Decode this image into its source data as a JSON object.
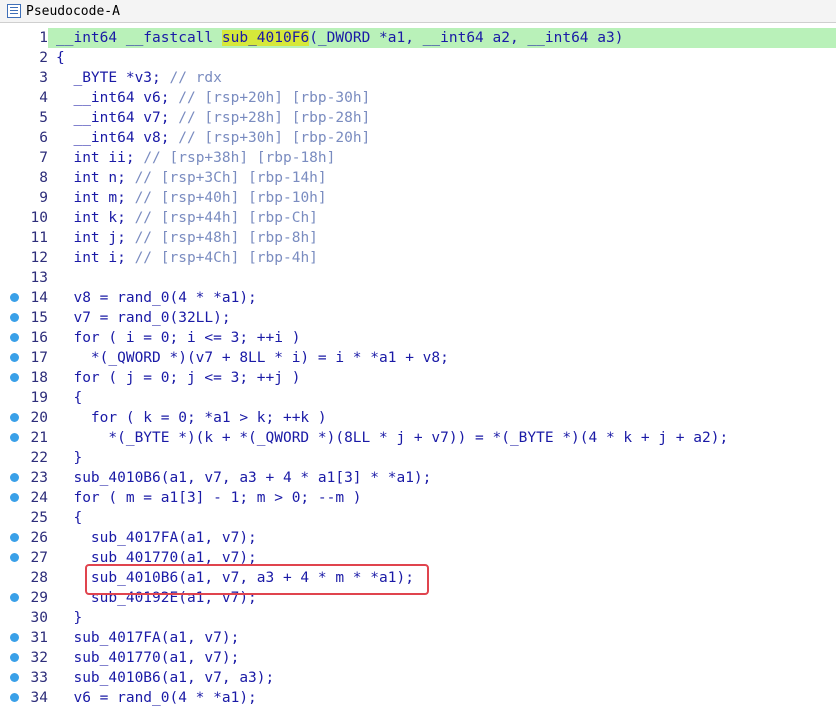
{
  "window": {
    "title": "Pseudocode-A",
    "icon": "pseudocode-window-icon"
  },
  "colors": {
    "current_line": "#b9f1b9",
    "breakpoint": "#3aa0e8",
    "highlight_box": "#e0444e",
    "symbol_highlight": "#d6e83a"
  },
  "lines": [
    {
      "n": "1",
      "bp": false,
      "text": "__int64 __fastcall sub_4010F6(_DWORD *a1, __int64 a2, __int64 a3)",
      "cm": ""
    },
    {
      "n": "2",
      "bp": false,
      "text": "{",
      "cm": ""
    },
    {
      "n": "3",
      "bp": false,
      "text": "  _BYTE *v3; ",
      "cm": "// rdx"
    },
    {
      "n": "4",
      "bp": false,
      "text": "  __int64 v6; ",
      "cm": "// [rsp+20h] [rbp-30h]"
    },
    {
      "n": "5",
      "bp": false,
      "text": "  __int64 v7; ",
      "cm": "// [rsp+28h] [rbp-28h]"
    },
    {
      "n": "6",
      "bp": false,
      "text": "  __int64 v8; ",
      "cm": "// [rsp+30h] [rbp-20h]"
    },
    {
      "n": "7",
      "bp": false,
      "text": "  int ii; ",
      "cm": "// [rsp+38h] [rbp-18h]"
    },
    {
      "n": "8",
      "bp": false,
      "text": "  int n; ",
      "cm": "// [rsp+3Ch] [rbp-14h]"
    },
    {
      "n": "9",
      "bp": false,
      "text": "  int m; ",
      "cm": "// [rsp+40h] [rbp-10h]"
    },
    {
      "n": "10",
      "bp": false,
      "text": "  int k; ",
      "cm": "// [rsp+44h] [rbp-Ch]"
    },
    {
      "n": "11",
      "bp": false,
      "text": "  int j; ",
      "cm": "// [rsp+48h] [rbp-8h]"
    },
    {
      "n": "12",
      "bp": false,
      "text": "  int i; ",
      "cm": "// [rsp+4Ch] [rbp-4h]"
    },
    {
      "n": "13",
      "bp": false,
      "text": "",
      "cm": ""
    },
    {
      "n": "14",
      "bp": true,
      "text": "  v8 = rand_0(4 * *a1);",
      "cm": ""
    },
    {
      "n": "15",
      "bp": true,
      "text": "  v7 = rand_0(32LL);",
      "cm": ""
    },
    {
      "n": "16",
      "bp": true,
      "text": "  for ( i = 0; i <= 3; ++i )",
      "cm": ""
    },
    {
      "n": "17",
      "bp": true,
      "text": "    *(_QWORD *)(v7 + 8LL * i) = i * *a1 + v8;",
      "cm": ""
    },
    {
      "n": "18",
      "bp": true,
      "text": "  for ( j = 0; j <= 3; ++j )",
      "cm": ""
    },
    {
      "n": "19",
      "bp": false,
      "text": "  {",
      "cm": ""
    },
    {
      "n": "20",
      "bp": true,
      "text": "    for ( k = 0; *a1 > k; ++k )",
      "cm": ""
    },
    {
      "n": "21",
      "bp": true,
      "text": "      *(_BYTE *)(k + *(_QWORD *)(8LL * j + v7)) = *(_BYTE *)(4 * k + j + a2);",
      "cm": ""
    },
    {
      "n": "22",
      "bp": false,
      "text": "  }",
      "cm": ""
    },
    {
      "n": "23",
      "bp": true,
      "text": "  sub_4010B6(a1, v7, a3 + 4 * a1[3] * *a1);",
      "cm": ""
    },
    {
      "n": "24",
      "bp": true,
      "text": "  for ( m = a1[3] - 1; m > 0; --m )",
      "cm": ""
    },
    {
      "n": "25",
      "bp": false,
      "text": "  {",
      "cm": ""
    },
    {
      "n": "26",
      "bp": true,
      "text": "    sub_4017FA(a1, v7);",
      "cm": ""
    },
    {
      "n": "27",
      "bp": true,
      "text": "    sub_401770(a1, v7);",
      "cm": ""
    },
    {
      "n": "28",
      "bp": false,
      "text": "    sub_4010B6(a1, v7, a3 + 4 * m * *a1);",
      "cm": ""
    },
    {
      "n": "29",
      "bp": true,
      "text": "    sub_40192E(a1, v7);",
      "cm": ""
    },
    {
      "n": "30",
      "bp": false,
      "text": "  }",
      "cm": ""
    },
    {
      "n": "31",
      "bp": true,
      "text": "  sub_4017FA(a1, v7);",
      "cm": ""
    },
    {
      "n": "32",
      "bp": true,
      "text": "  sub_401770(a1, v7);",
      "cm": ""
    },
    {
      "n": "33",
      "bp": true,
      "text": "  sub_4010B6(a1, v7, a3);",
      "cm": ""
    },
    {
      "n": "34",
      "bp": true,
      "text": "  v6 = rand_0(4 * *a1);",
      "cm": ""
    }
  ]
}
